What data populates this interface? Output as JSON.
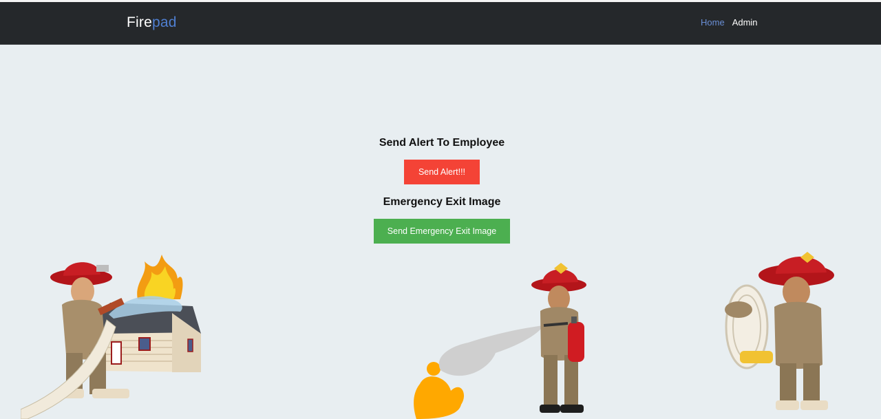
{
  "brand": {
    "part1": "Fire",
    "part2": "pad"
  },
  "nav": {
    "home": "Home",
    "admin": "Admin"
  },
  "alert_section": {
    "heading": "Send Alert To Employee",
    "button": "Send Alert!!!"
  },
  "exit_section": {
    "heading": "Emergency Exit Image",
    "button": "Send Emergency Exit Image"
  },
  "colors": {
    "navbar_bg": "#25282b",
    "page_bg": "#e8eef1",
    "brand_accent": "#4f7fd1",
    "alert_button": "#f44336",
    "exit_button": "#4caf50"
  }
}
